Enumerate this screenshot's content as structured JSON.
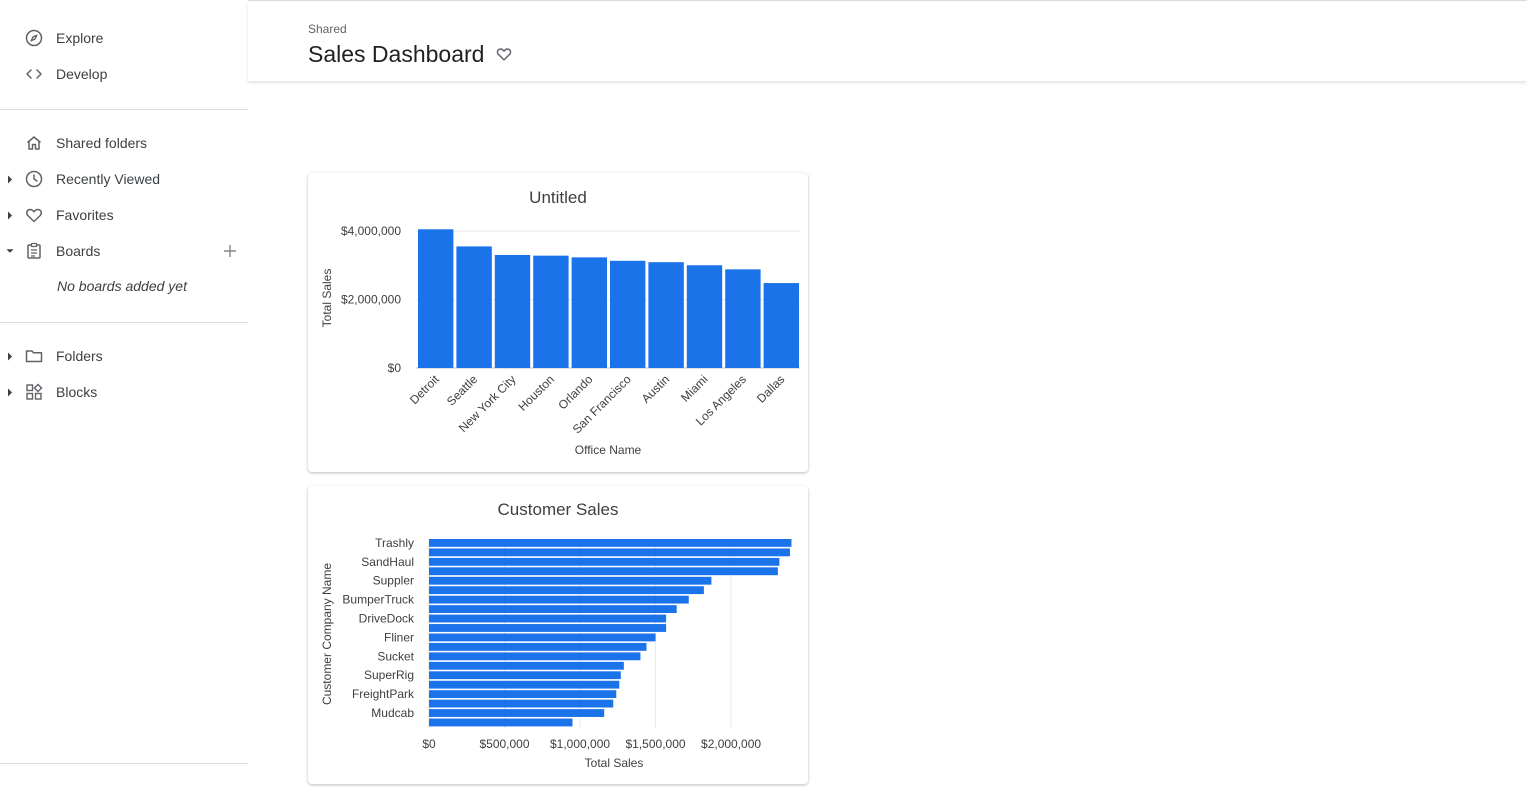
{
  "sidebar": {
    "explore_label": "Explore",
    "develop_label": "Develop",
    "shared_folders_label": "Shared folders",
    "recently_viewed_label": "Recently Viewed",
    "favorites_label": "Favorites",
    "boards_label": "Boards",
    "boards_empty": "No boards added yet",
    "folders_label": "Folders",
    "blocks_label": "Blocks"
  },
  "header": {
    "breadcrumb": "Shared",
    "title": "Sales Dashboard"
  },
  "colors": {
    "bar": "#1a73e8",
    "text": "#3c4043",
    "grid": "#e8eaed"
  },
  "chart_data": [
    {
      "type": "bar",
      "title": "Untitled",
      "xlabel": "Office Name",
      "ylabel": "Total Sales",
      "categories": [
        "Detroit",
        "Seattle",
        "New York City",
        "Houston",
        "Orlando",
        "San Francisco",
        "Austin",
        "Miami",
        "Los Angeles",
        "Dallas"
      ],
      "values": [
        4050000,
        3550000,
        3300000,
        3280000,
        3230000,
        3130000,
        3090000,
        3000000,
        2880000,
        2480000
      ],
      "ylim": [
        0,
        4000000
      ],
      "yticks": [
        0,
        2000000,
        4000000
      ],
      "ytick_labels": [
        "$0",
        "$2,000,000",
        "$4,000,000"
      ],
      "grid": true
    },
    {
      "type": "bar",
      "orientation": "horizontal",
      "title": "Customer Sales",
      "xlabel": "Total Sales",
      "ylabel": "Customer Company Name",
      "categories": [
        "Trashly",
        "",
        "SandHaul",
        "",
        "Suppler",
        "",
        "BumperTruck",
        "",
        "DriveDock",
        "",
        "Fliner",
        "",
        "Sucket",
        "",
        "SuperRig",
        "",
        "FreightPark",
        "",
        "Mudcab",
        ""
      ],
      "values": [
        2400000,
        2390000,
        2320000,
        2310000,
        1870000,
        1820000,
        1720000,
        1640000,
        1570000,
        1570000,
        1500000,
        1440000,
        1400000,
        1290000,
        1270000,
        1260000,
        1240000,
        1220000,
        1160000,
        950000
      ],
      "xlim": [
        0,
        2430000
      ],
      "xticks": [
        0,
        500000,
        1000000,
        1500000,
        2000000
      ],
      "xtick_labels": [
        "$0",
        "$500,000",
        "$1,000,000",
        "$1,500,000",
        "$2,000,000"
      ],
      "grid": true
    }
  ]
}
